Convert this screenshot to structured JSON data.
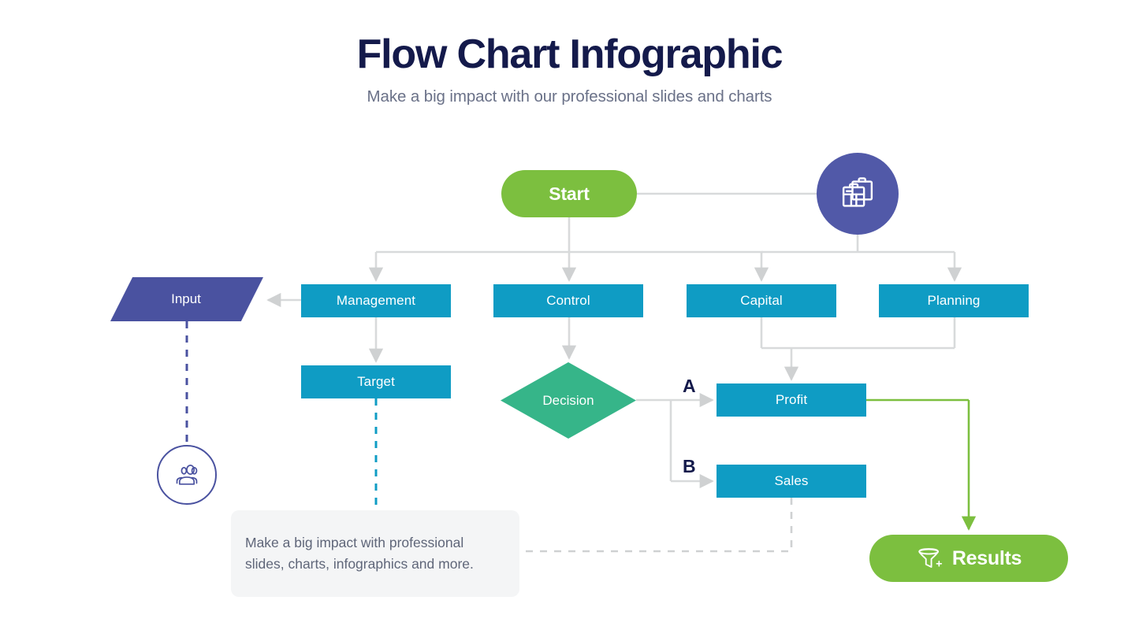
{
  "header": {
    "title": "Flow Chart Infographic",
    "subtitle": "Make a big impact with our professional slides and charts"
  },
  "nodes": {
    "start": "Start",
    "input": "Input",
    "management": "Management",
    "control": "Control",
    "capital": "Capital",
    "planning": "Planning",
    "target": "Target",
    "decision": "Decision",
    "profit": "Profit",
    "sales": "Sales",
    "results": "Results"
  },
  "branches": {
    "a": "A",
    "b": "B"
  },
  "note": {
    "text": "Make a big impact with professional slides, charts, infographics and more."
  },
  "icons": {
    "briefcase": "briefcase-icon",
    "people": "people-group-icon",
    "funnel": "funnel-plus-icon"
  },
  "colors": {
    "green": "#7cbf3f",
    "teal": "#0f9cc4",
    "purple": "#4a52a0",
    "purple_circle": "#5159a8",
    "emerald": "#36b589",
    "navy": "#141a4b",
    "gray_line": "#d5d7d8",
    "note_bg": "#f4f5f6",
    "subtitle": "#6a7188"
  }
}
